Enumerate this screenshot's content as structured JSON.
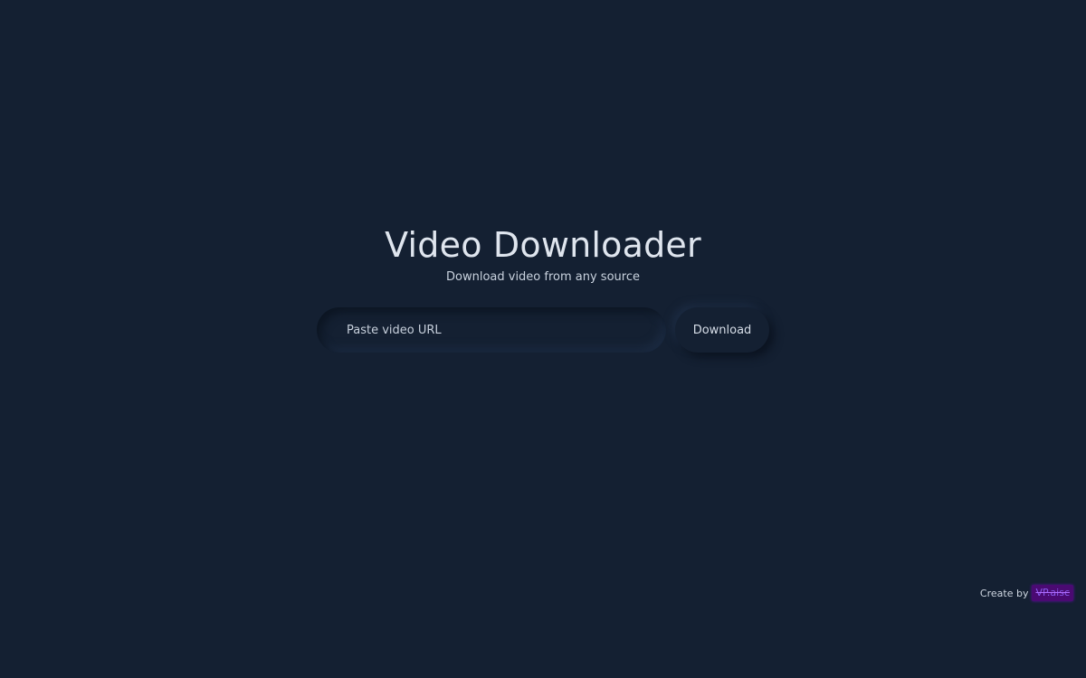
{
  "header": {
    "title": "Video Downloader",
    "subtitle": "Download video from any source"
  },
  "form": {
    "url_placeholder": "Paste video URL",
    "url_value": "",
    "download_label": "Download"
  },
  "footer": {
    "credit_label": "Create by",
    "author_name": "VP.aisc"
  },
  "colors": {
    "background": "#142032",
    "text": "#dfe5ee",
    "author_badge": "#4a0a72",
    "author_text": "#8a5cf0"
  }
}
